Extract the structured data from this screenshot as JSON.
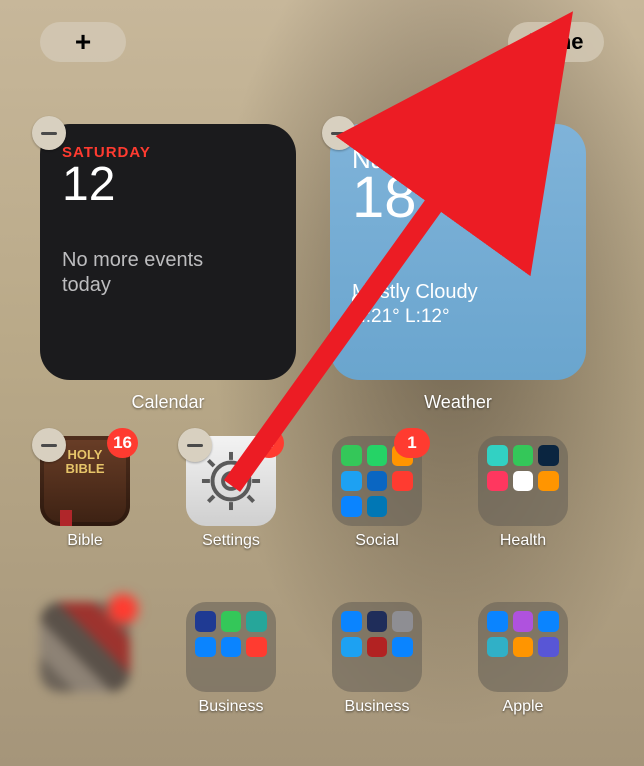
{
  "topbar": {
    "add_glyph": "+",
    "done_label": "Done"
  },
  "calendar": {
    "day_label": "SATURDAY",
    "date": "12",
    "message": "No more events today",
    "widget_label": "Calendar"
  },
  "weather": {
    "city": "Nairobi",
    "temp": "18°",
    "condition": "Mostly Cloudy",
    "high_low": "H:21° L:12°",
    "widget_label": "Weather"
  },
  "apps": {
    "bible": {
      "label": "Bible",
      "badge": "16",
      "icon_line1": "HOLY",
      "icon_line2": "BIBLE"
    },
    "settings": {
      "label": "Settings",
      "badge": "4"
    },
    "social": {
      "label": "Social",
      "badge": "1",
      "mini_colors": [
        "#34c759",
        "#25d366",
        "#ff9500",
        "#1da1f2",
        "#0a66c2",
        "#ff3b30",
        "#0a84ff",
        "#0077b5"
      ]
    },
    "health": {
      "label": "Health",
      "mini_colors": [
        "#32d1c3",
        "#34c759",
        "#0a2540",
        "#ff375f",
        "#ffffff",
        "#ff9500"
      ]
    },
    "blurred": {
      "label": ""
    },
    "business1": {
      "label": "Business",
      "mini_colors": [
        "#1f3a93",
        "#34c759",
        "#26a69a",
        "#0a84ff",
        "#0a84ff",
        "#ff3b30"
      ]
    },
    "business2": {
      "label": "Business",
      "mini_colors": [
        "#0a84ff",
        "#1f2d5a",
        "#8e8e93",
        "#1da1f2",
        "#b22222",
        "#0a84ff"
      ]
    },
    "apple": {
      "label": "Apple",
      "mini_colors": [
        "#0a84ff",
        "#af52de",
        "#0a84ff",
        "#30b0c7",
        "#ff9500",
        "#5856d6"
      ]
    }
  },
  "colors": {
    "notif_red": "#ff3b30",
    "arrow_red": "#ec1c24"
  }
}
